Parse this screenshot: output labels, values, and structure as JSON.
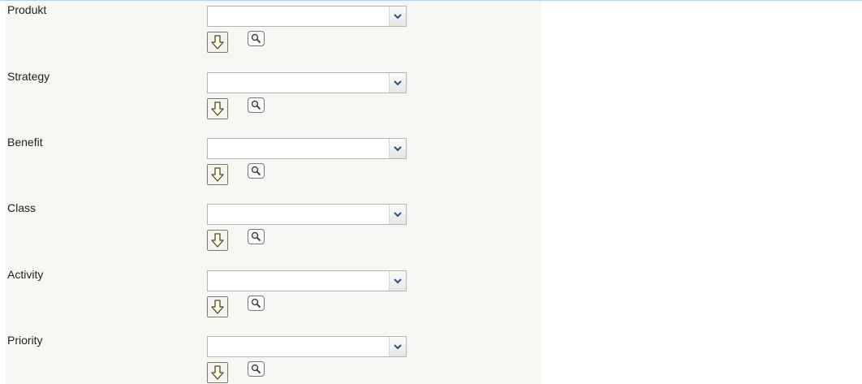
{
  "form": {
    "fields": [
      {
        "label": "Produkt",
        "value": ""
      },
      {
        "label": "Strategy",
        "value": ""
      },
      {
        "label": "Benefit",
        "value": ""
      },
      {
        "label": "Class",
        "value": ""
      },
      {
        "label": "Activity",
        "value": ""
      },
      {
        "label": "Priority",
        "value": ""
      }
    ],
    "icons": {
      "dropdown": "chevron-down-icon",
      "transfer": "arrow-down-icon",
      "lookup": "magnifier-icon"
    },
    "colors": {
      "panel_background": "#f6f6f2",
      "chevron": "#2a4f86",
      "arrow_fill": "#ffffd8"
    }
  }
}
